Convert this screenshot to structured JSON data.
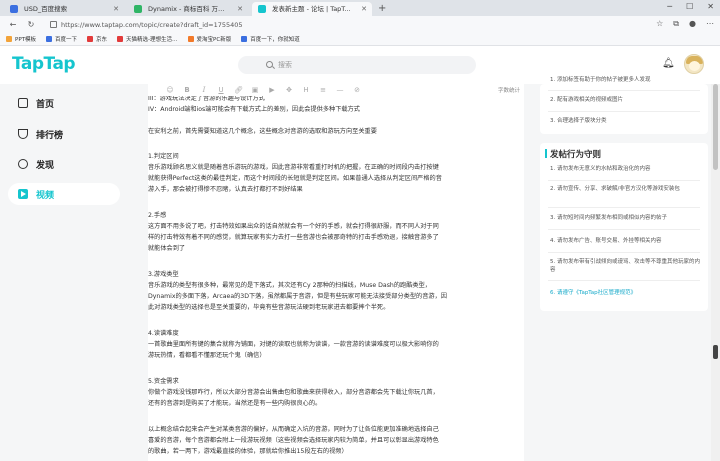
{
  "browser": {
    "tabs": [
      {
        "label": "USD_百度搜索",
        "color": "#3b6fe0",
        "active": false
      },
      {
        "label": "Dynamix - 商标百科 万有留可用…",
        "color": "#2fb566",
        "active": false
      },
      {
        "label": "发表新主题 - 论坛 | TapTap 发现…",
        "color": "#15c5ce",
        "active": true
      }
    ],
    "url": "https://www.taptap.com/topic/create?draft_id=1755405",
    "bookmarks": [
      {
        "label": "PPT模板",
        "color": "#f2a33a"
      },
      {
        "label": "百度一下",
        "color": "#3b6fe0"
      },
      {
        "label": "京东",
        "color": "#e23b3b"
      },
      {
        "label": "天猫精选-理想生活…",
        "color": "#e23b3b"
      },
      {
        "label": "爱淘宝PC新版",
        "color": "#f27a2a"
      },
      {
        "label": "百度一下，你就知道",
        "color": "#3b6fe0"
      }
    ]
  },
  "header": {
    "logo": "TapTap",
    "search_placeholder": "搜索"
  },
  "sidebar": {
    "items": [
      {
        "label": "首页",
        "icon": "home-icon",
        "active": false
      },
      {
        "label": "排行榜",
        "icon": "trophy-icon",
        "active": false
      },
      {
        "label": "发现",
        "icon": "discover-icon",
        "active": false
      },
      {
        "label": "视频",
        "icon": "video-icon",
        "active": true
      }
    ]
  },
  "editor": {
    "word_count": "字数统计",
    "lines": [
      "III：游戏玩法决定了音游的乐趣与设计方式",
      "IV：Android端和ios端可能会有下载方式上的差别，因此会提供多种下载方式",
      "",
      "在安利之前，首先需要知道这几个概念，这些概念对音游的选取和游玩方向至关重要",
      "",
      "1.判定区间",
      "音乐游戏顾名思义就是随着音乐游玩的游戏，因此音游非常看重打时机的把握，在正确的时间段内击打按键",
      "就能获得Perfect这类的最佳判定，而这个时间段的长短就是判定区间。如果普通人选择从判定区间严格的音",
      "游入手，那会被打得惨不忍睹，认真去打都打不到好结果",
      "",
      "2.手感",
      "这方面不用多说了吧，打击特效如果出众的话自然就会有一个好的手感，就会打得很舒服，而不同人对于同",
      "样的打击特效有着不同的感觉，就算玩家有实力去打一些音游也会被那奇特的打击手感劝退，接触音游多了",
      "就能体会到了",
      "",
      "3.游戏类型",
      "音乐游戏的类型有很多种，最常见的是下落式，其次还有Cy 2那种的扫描线，Muse Dash的跑酷类型，",
      "Dynamix的多面下落，Arcaea的3D下落，虽然都属于音游，但是有些玩家可能无法接受部分类型的音游，因",
      "此对游戏类型的选择也是至关重要的，毕竟有些音游玩法硬到老玩家进去都要摔个半死。",
      "",
      "4.读谱难度",
      "一首歌曲里面所有键的集合就称为铺面，对键的读取也就称为读谱，一款音游的读谱难度可以极大影响你的",
      "游玩热情，看都看不懂那还玩个鬼（确信）",
      "",
      "5.资金需求",
      "你做个游戏没钱那咋行，所以大部分音游会出售曲包和歌曲来获得收入，部分音游都会先下载让你玩几首，",
      "还有的音游到是购买了才能玩，当然还是有一些内购很良心的。",
      "",
      "以上概念结合起来会产生对某类音游的偏好，从而确定入坑的音游，同时为了让各位能更加准确地选择自己",
      "喜爱的音游，每个音游都会附上一段游玩视频（这些视频会选择玩家内较为简单，并且可以彰显出游戏特色",
      "的歌曲，若一两下，游戏最直接的体验，那就给你推出15段左右的视频）"
    ]
  },
  "tips_panel": {
    "items": [
      "1. 添加标签有助于你的帖子被更多人发现",
      "2. 配有游戏相关的视频或图片",
      "3. 合理选择子版块分类"
    ]
  },
  "rules_panel": {
    "title": "发帖行为守则",
    "items": [
      "1. 请勿发布无意义的水帖和政治化的内容",
      "2. 请勿宣传、分享、求破解/非官方汉化等游戏安装包",
      "3. 请勿短时间内频繁发布相同或相似内容的帖子",
      "4. 请勿发布广告、账号交易、外挂等相关内容",
      "5. 请勿发布带有引战倾向或谩骂、攻击等不尊重其他玩家的内容",
      "6. 请遵守《TapTap社区管理规范》"
    ]
  }
}
